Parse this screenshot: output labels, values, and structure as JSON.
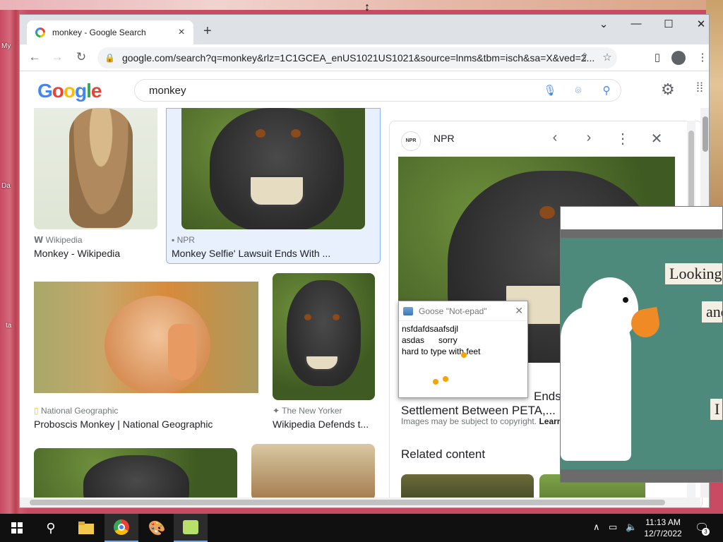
{
  "desktop": {
    "labels": [
      "My",
      "Da",
      "ta"
    ]
  },
  "browser": {
    "tab_title": "monkey - Google Search",
    "url": "google.com/search?q=monkey&rlz=1C1GCEA_enUS1021US1021&source=lnms&tbm=isch&sa=X&ved=2...",
    "window_controls": {
      "dropdown": "⌄",
      "minimize": "—",
      "maximize": "☐",
      "close": "✕"
    }
  },
  "google": {
    "logo": "Google",
    "query": "monkey"
  },
  "results": [
    {
      "source": "Wikipedia",
      "title": "Monkey - Wikipedia"
    },
    {
      "source": "NPR",
      "title": "Monkey Selfie' Lawsuit Ends With ..."
    },
    {
      "source": "National Geographic",
      "title": "Proboscis Monkey | National Geographic"
    },
    {
      "source": "The New Yorker",
      "title": "Wikipedia Defends t..."
    }
  ],
  "panel": {
    "source": "NPR",
    "source_icon_text": "NPR",
    "title_line1": "Ends",
    "title_line2": "Settlement Between PETA,...",
    "copyright": "Images may be subject to copyright.",
    "learn": "Learn",
    "related": "Related content"
  },
  "notepad": {
    "title": "Goose \"Not-epad\"",
    "text": "nsfdafdsaafsdjl\nasdas      sorry\nhard to type with feet"
  },
  "meme": {
    "line1": "Looking",
    "line2": "and",
    "line3": "I"
  },
  "taskbar": {
    "time": "11:13 AM",
    "date": "12/7/2022",
    "notifications": "3"
  },
  "colors": {
    "google_blue": "#4285f4",
    "google_red": "#ea4335",
    "google_yellow": "#fbbc05",
    "google_green": "#34a853",
    "selected_border": "#8ab4f8",
    "taskbar": "#101010"
  }
}
